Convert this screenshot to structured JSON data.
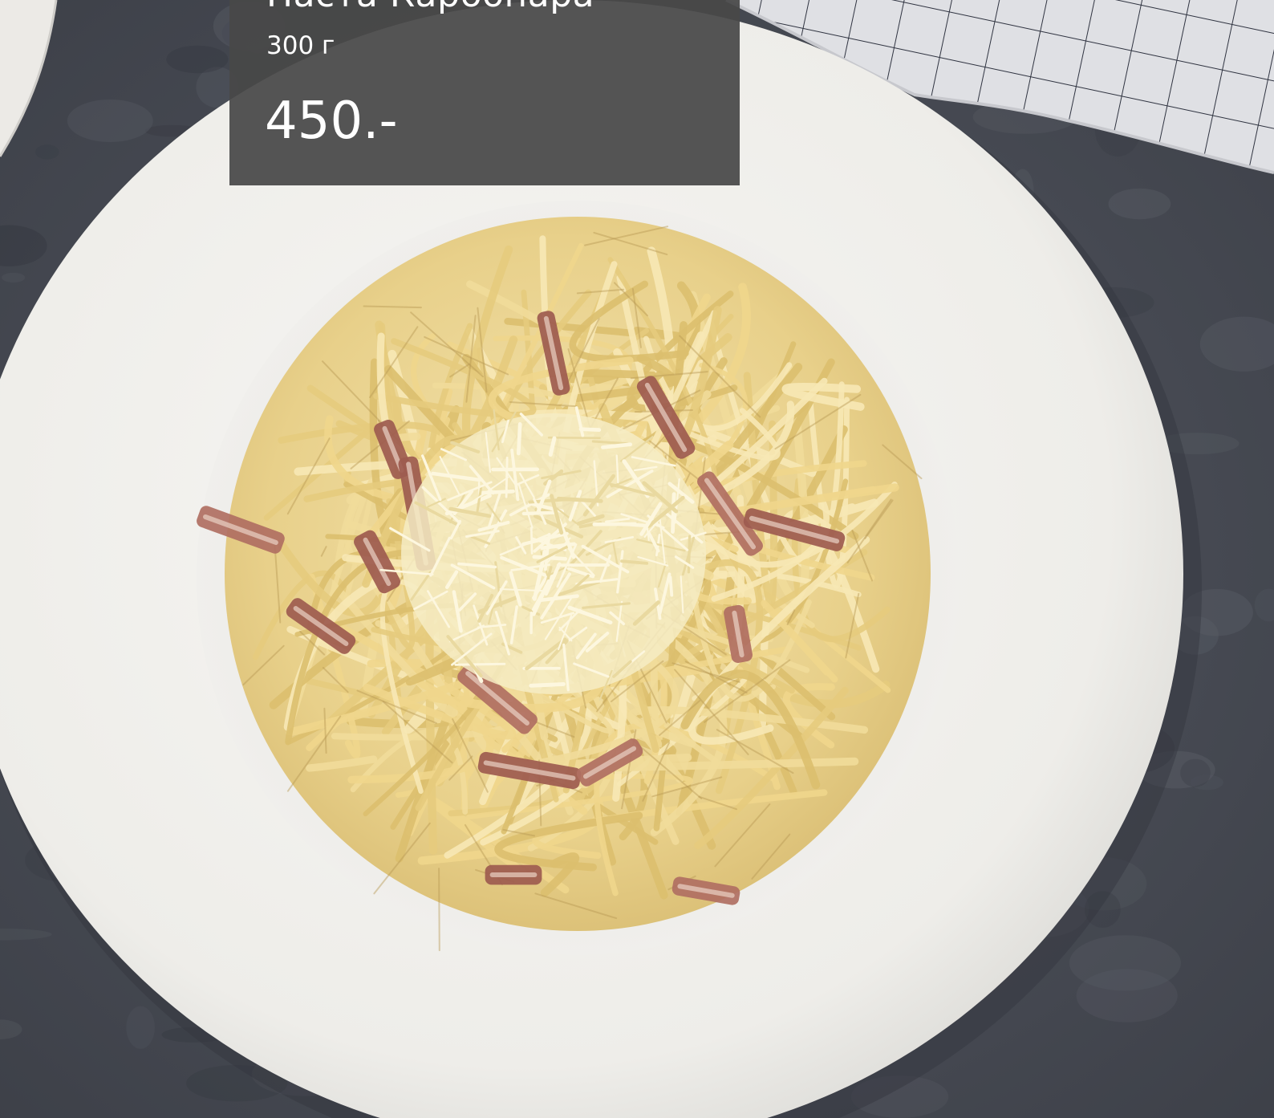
{
  "menu_card": {
    "name": "Паста Карбонара",
    "weight": "300 г",
    "price": "450.-"
  },
  "photo": {
    "subject": "pasta-carbonara-plate",
    "colors": {
      "table": "#4a4e57",
      "plate": "#f2f1ee",
      "pasta": "#ead38d",
      "bacon": "#a9685c",
      "cheese": "#fbf3d2",
      "napkin": "#dfe0e4"
    }
  }
}
